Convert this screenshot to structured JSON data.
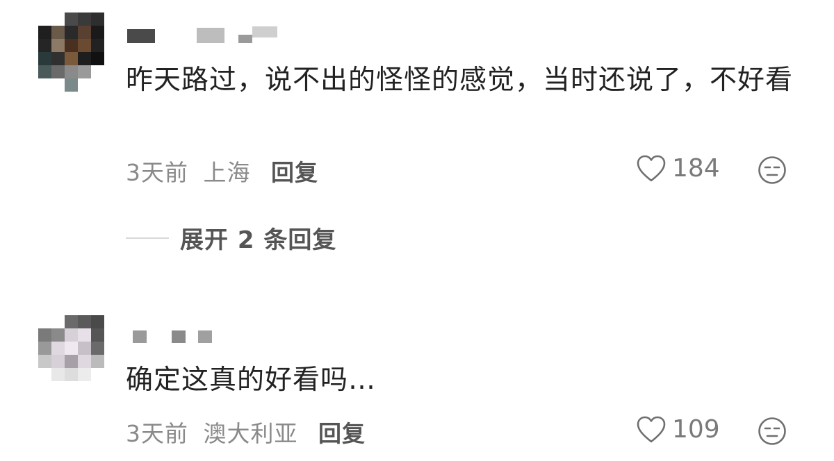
{
  "comments": [
    {
      "text": "昨天路过，说不出的怪怪的感觉，当时还说了，不好看",
      "time": "3天前",
      "location": "上海",
      "reply_label": "回复",
      "likes": "184",
      "expand_label": "展开 2 条回复"
    },
    {
      "text": "确定这真的好看吗…",
      "time": "3天前",
      "location": "澳大利亚",
      "reply_label": "回复",
      "likes": "109"
    }
  ],
  "icons": {
    "like": "heart-outline-icon",
    "emoji": "neutral-face-icon"
  },
  "colors": {
    "text": "#222222",
    "meta": "#8a8a8a",
    "icon": "#6f6f6f"
  }
}
